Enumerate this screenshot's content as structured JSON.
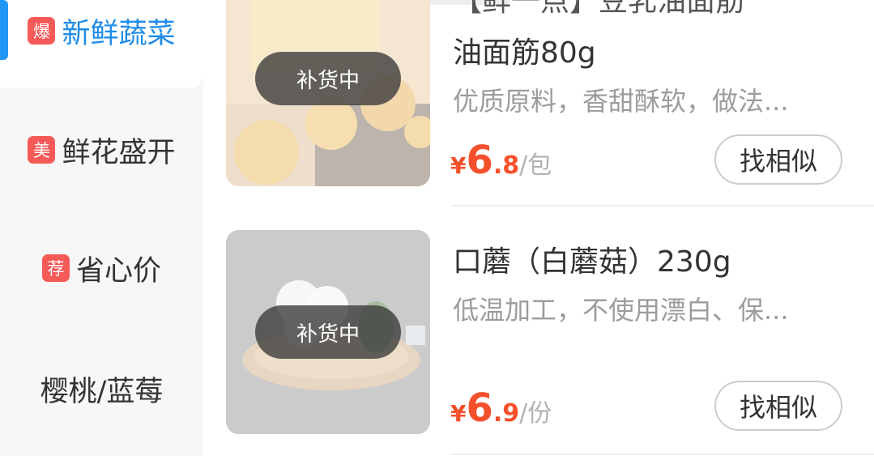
{
  "sidebar": {
    "items": [
      {
        "tag": "爆",
        "label": "新鲜蔬菜",
        "active": true
      },
      {
        "tag": "美",
        "label": "鲜花盛开",
        "active": false
      },
      {
        "tag": "荐",
        "label": "省心价",
        "active": false
      },
      {
        "tag": "",
        "label": "樱桃/蓝莓",
        "active": false
      }
    ]
  },
  "products": [
    {
      "title_partial": "【鲜一点】豆乳油面筋",
      "title": "油面筋80g",
      "desc": "优质原料，香甜酥软，做法...",
      "status": "补货中",
      "price_currency": "¥",
      "price_int": "6",
      "price_dec": ".8",
      "price_unit": "/包",
      "similar_label": "找相似"
    },
    {
      "title": "口蘑（白蘑菇）230g",
      "desc": "低温加工，不使用漂白、保...",
      "status": "补货中",
      "price_currency": "¥",
      "price_int": "6",
      "price_dec": ".9",
      "price_unit": "/份",
      "similar_label": "找相似"
    }
  ],
  "colors": {
    "accent": "#2196f3",
    "tag": "#f45a58",
    "price": "#f4502c"
  }
}
